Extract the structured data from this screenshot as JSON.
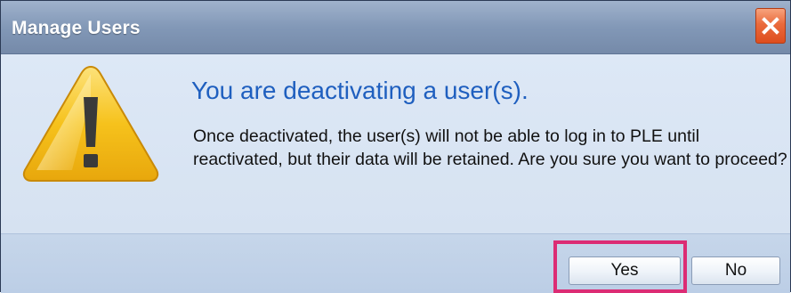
{
  "window": {
    "title": "Manage Users",
    "close_icon": "close-x-icon"
  },
  "dialog": {
    "icon": "warning-triangle-icon",
    "heading": "You are deactivating a user(s).",
    "message": "Once deactivated, the user(s) will not be able to log in to PLE until reactivated, but their data will be retained. Are you sure you want to proceed?"
  },
  "buttons": {
    "yes_label": "Yes",
    "no_label": "No"
  },
  "colors": {
    "heading": "#1f5fbf",
    "highlight": "#dc2c74",
    "close_button": "#e0572a",
    "warning_fill": "#f6c21c"
  }
}
